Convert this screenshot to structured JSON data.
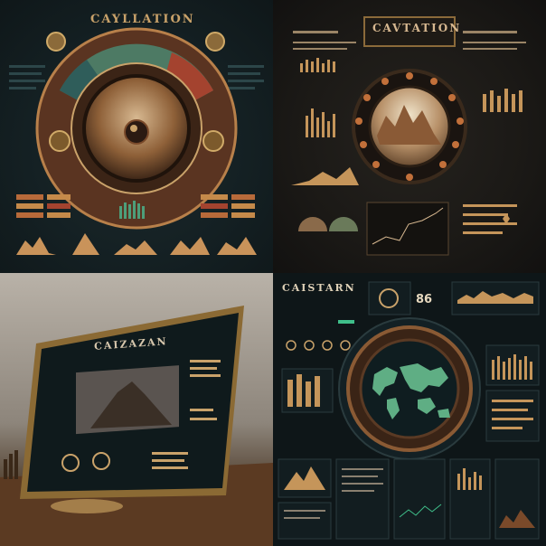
{
  "colors": {
    "gold": "#c9a26a",
    "bronze": "#8b5a34",
    "teal_bg": "#142023",
    "green_accent": "#3f7a5a",
    "red_accent": "#a4432f",
    "dark_brown": "#1b1916"
  },
  "panels": {
    "top_left": {
      "title": "CAYLLATION",
      "icon": "circular-dial"
    },
    "top_right": {
      "title": "CAVTATION",
      "icon": "city-porthole"
    },
    "bottom_left": {
      "title": "CAIZAZAN",
      "icon": "monitor-display"
    },
    "bottom_right": {
      "title": "CAISTARN",
      "badge": "86",
      "icon": "world-map-dial"
    }
  }
}
